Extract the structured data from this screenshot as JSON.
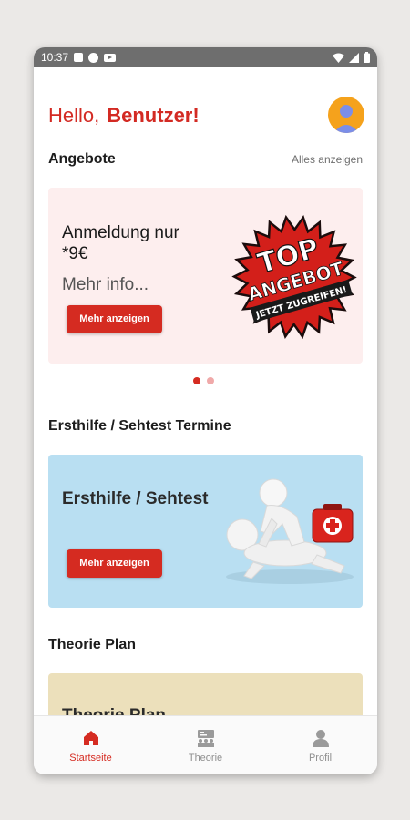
{
  "status_bar": {
    "time": "10:37"
  },
  "header": {
    "greeting": "Hello,",
    "user_name": "Benutzer!"
  },
  "offers": {
    "title": "Angebote",
    "see_all": "Alles anzeigen",
    "card": {
      "title": "Anmeldung nur *9€",
      "subtitle": "Mehr info...",
      "button": "Mehr anzeigen",
      "badge_lines": [
        "TOP",
        "ANGEBOT",
        "JETZT ZUGREIFEN!"
      ]
    },
    "carousel_pages": 2,
    "carousel_active": 1
  },
  "first_aid": {
    "title": "Ersthilfe / Sehtest Termine",
    "card": {
      "title": "Ersthilfe / Sehtest",
      "button": "Mehr anzeigen"
    }
  },
  "theory": {
    "title": "Theorie Plan",
    "card": {
      "title": "Theorie Plan"
    }
  },
  "bottom_nav": {
    "items": [
      {
        "label": "Startseite",
        "icon": "home-icon",
        "active": true
      },
      {
        "label": "Theorie",
        "icon": "theory-icon",
        "active": false
      },
      {
        "label": "Profil",
        "icon": "profile-icon",
        "active": false
      }
    ]
  },
  "colors": {
    "accent": "#d52b21",
    "offer_bg": "#fdeeee",
    "first_aid_bg": "#b9dff2",
    "theory_bg": "#ece0bb"
  }
}
